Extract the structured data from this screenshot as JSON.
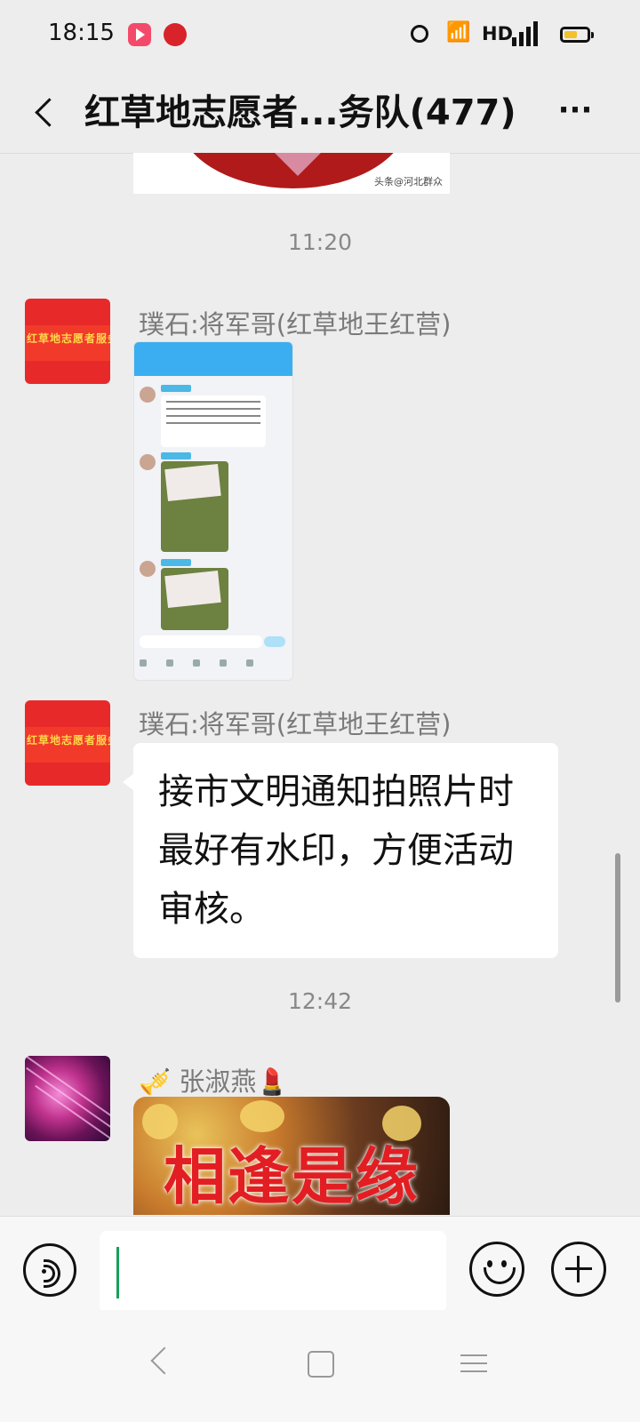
{
  "status_bar": {
    "time": "18:15",
    "network": "HD",
    "signal": "4G"
  },
  "header": {
    "title": "红草地志愿者...务队(477)",
    "more": "···"
  },
  "chat": {
    "top_image_watermark": "头条@河北群众",
    "messages": [
      {
        "type": "timestamp",
        "text": "11:20"
      },
      {
        "type": "image",
        "sender": "璞石:将军哥(红草地王红营)",
        "avatar_text": "红草地志愿者服务队"
      },
      {
        "type": "text",
        "sender": "璞石:将军哥(红草地王红营)",
        "avatar_text": "红草地志愿者服务队",
        "text": "接市文明通知拍照片时最好有水印，方便活动审核。"
      },
      {
        "type": "timestamp",
        "text": "12:42"
      },
      {
        "type": "sticker",
        "sender": "🎺 张淑燕💄",
        "sticker_text": "相逢是缘"
      }
    ]
  },
  "input": {
    "placeholder": ""
  }
}
